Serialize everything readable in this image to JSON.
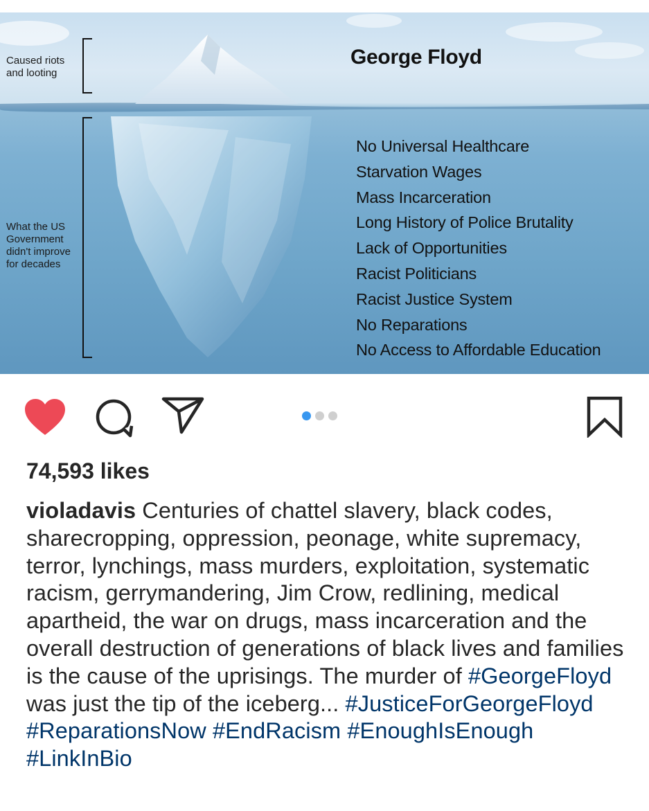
{
  "post": {
    "image": {
      "top_label": "Caused riots\nand looting",
      "bottom_label": "What the US\nGovernment\ndidn't improve\nfor decades",
      "title": "George Floyd",
      "causes": [
        "No Universal Healthcare",
        "Starvation Wages",
        "Mass Incarceration",
        "Long History of Police Brutality",
        "Lack of Opportunities",
        "Racist Politicians",
        "Racist Justice System",
        "No Reparations",
        "No Access to Affordable Education"
      ]
    },
    "actions": {
      "like_icon": "heart-icon",
      "comment_icon": "comment-icon",
      "share_icon": "send-icon",
      "save_icon": "bookmark-icon",
      "liked": true,
      "like_color": "#ed4956",
      "carousel": {
        "count": 3,
        "active_index": 0,
        "active_color": "#3897f0"
      }
    },
    "likes": "74,593 likes",
    "caption": {
      "username": "violadavis",
      "text": " Centuries of chattel slavery, black codes, sharecropping, oppression, peonage, white supremacy, terror, lynchings, mass murders, exploitation, systematic racism, gerrymandering, Jim Crow, redlining, medical apartheid, the war on drugs, mass incarceration and the overall destruction of generations of black lives and families is the cause of the uprisings. The murder of ",
      "hashtag1": "#GeorgeFloyd",
      "text2": " was just the tip of the iceberg... ",
      "hashtags": [
        "#JusticeForGeorgeFloyd",
        "#ReparationsNow",
        "#EndRacism",
        "#EnoughIsEnough",
        "#LinkInBio"
      ],
      "hashtag_color": "#003569"
    }
  }
}
